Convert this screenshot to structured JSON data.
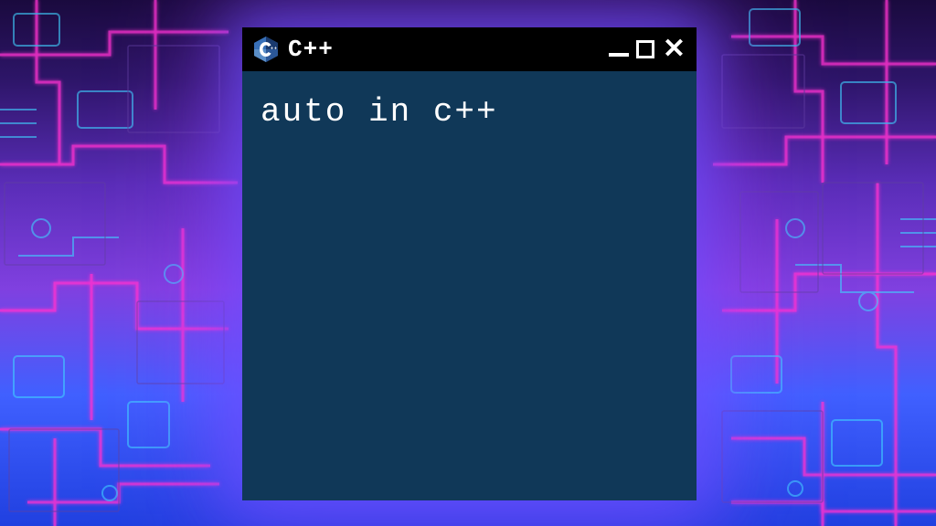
{
  "window": {
    "title": "C++",
    "icon_name": "cpp-hexagon-icon"
  },
  "content": {
    "text": "auto in c++"
  },
  "colors": {
    "titlebar_bg": "#000000",
    "content_bg": "#103858",
    "text": "#ffffff",
    "icon_primary": "#2b5797",
    "icon_light": "#5a8ec7"
  }
}
